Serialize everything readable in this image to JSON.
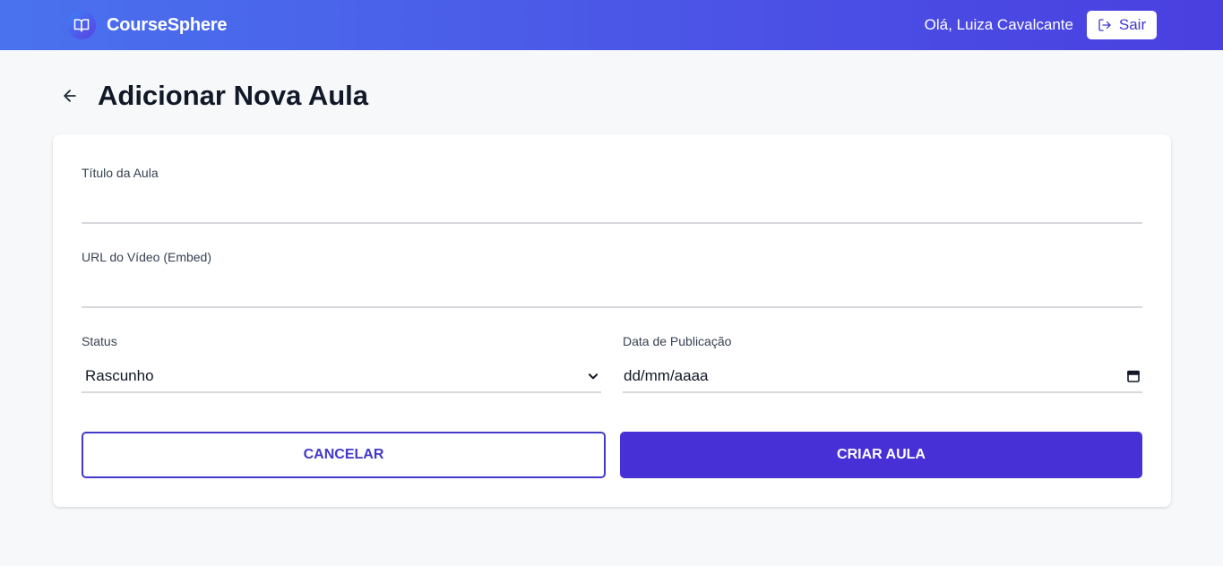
{
  "header": {
    "brand": "CourseSphere",
    "greeting": "Olá, Luiza Cavalcante",
    "logout_label": "Sair"
  },
  "page": {
    "title": "Adicionar Nova Aula"
  },
  "form": {
    "title_label": "Título da Aula",
    "title_value": "",
    "url_label": "URL do Vídeo (Embed)",
    "url_value": "",
    "status_label": "Status",
    "status_value": "Rascunho",
    "date_label": "Data de Publicação",
    "date_placeholder": "dd/mm/aaaa",
    "cancel_label": "CANCELAR",
    "submit_label": "CRIAR AULA"
  },
  "colors": {
    "primary": "#4630d6",
    "header_gradient_start": "#4a72ee",
    "header_gradient_end": "#4a3fe0",
    "background": "#f7f8fa"
  }
}
